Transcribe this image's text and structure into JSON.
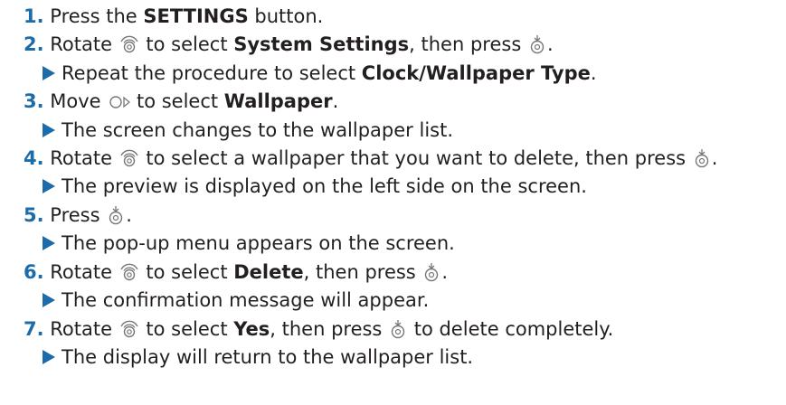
{
  "colors": {
    "accent": "#1b6ca8",
    "text": "#231f20",
    "icon": "#777777"
  },
  "icons": {
    "rotate": "rotary-dial-icon",
    "press": "press-dial-icon",
    "move": "move-right-dial-icon"
  },
  "steps": [
    {
      "num": "1.",
      "a": "Press the ",
      "b": "SETTINGS",
      "c": " button."
    },
    {
      "num": "2.",
      "a": "Rotate ",
      "b1": " to select ",
      "bold": "System Settings",
      "c": ", then press ",
      "d": ".",
      "sub": {
        "a": "Repeat the procedure to select ",
        "bold": "Clock/Wallpaper Type",
        "c": "."
      }
    },
    {
      "num": "3.",
      "a": "Move ",
      "b1": " to select ",
      "bold": "Wallpaper",
      "c": ".",
      "sub": {
        "text": "The screen changes to the wallpaper list."
      }
    },
    {
      "num": "4.",
      "a": "Rotate ",
      "b1": " to select a wallpaper that you want to delete, then press ",
      "c": ".",
      "sub": {
        "text": "The preview is displayed on the left side on the screen."
      }
    },
    {
      "num": "5.",
      "a": "Press ",
      "c": ".",
      "sub": {
        "text": "The pop-up menu appears on the screen."
      }
    },
    {
      "num": "6.",
      "a": "Rotate ",
      "b1": " to select ",
      "bold": "Delete",
      "c": ", then press ",
      "d": ".",
      "sub": {
        "text": "The confirmation message will appear."
      }
    },
    {
      "num": "7.",
      "a": "Rotate ",
      "b1": " to select ",
      "bold": "Yes",
      "c": ", then press ",
      "d": " to delete completely.",
      "sub": {
        "text": "The display will return to the wallpaper list."
      }
    }
  ]
}
